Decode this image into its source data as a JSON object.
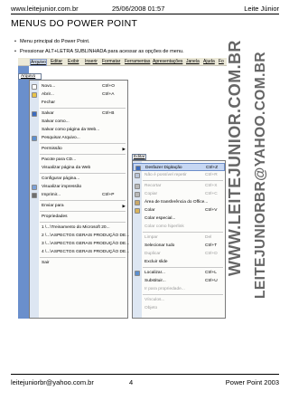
{
  "header": {
    "site": "www.leitejunior.com.br",
    "datetime": "25/06/2008 01:57",
    "author": "Leite Júnior"
  },
  "page_title": "MENUS DO POWER POINT",
  "bullets": [
    "Menu principal do Power Point.",
    "Pressionar ALT+LETRA SUBLINHADA para acessar as opções de menu."
  ],
  "menubar": [
    "Arquivo",
    "Editar",
    "Exibir",
    "Inserir",
    "Formatar",
    "Ferramentas",
    "Apresentações",
    "Janela",
    "Ajuda",
    "Fo"
  ],
  "arquivo_tab": "Arquivo",
  "arquivo_menu": [
    {
      "label": "Novo...",
      "shortcut": "Ctrl+O",
      "icon": "new-icon",
      "color": "#ffffff"
    },
    {
      "label": "Abrir...",
      "shortcut": "Ctrl+A",
      "icon": "open-folder-icon",
      "color": "#e8c34a"
    },
    {
      "label": "Fechar",
      "shortcut": "",
      "icon": "",
      "color": ""
    },
    {
      "sep": true
    },
    {
      "label": "Salvar",
      "shortcut": "Ctrl+B",
      "icon": "save-icon",
      "color": "#3c6cc0"
    },
    {
      "label": "Salvar como...",
      "shortcut": "",
      "icon": "",
      "color": ""
    },
    {
      "label": "Salvar como página da Web...",
      "shortcut": "",
      "icon": "",
      "color": ""
    },
    {
      "label": "Pesquisar Arquivo...",
      "shortcut": "",
      "icon": "search-file-icon",
      "color": "#5b8fd0"
    },
    {
      "sep": true
    },
    {
      "label": "Permissão",
      "shortcut": "",
      "icon": "",
      "color": "",
      "submenu": true
    },
    {
      "sep": true
    },
    {
      "label": "Pacote para CD...",
      "shortcut": "",
      "icon": "",
      "color": ""
    },
    {
      "label": "Visualizar página da Web",
      "shortcut": "",
      "icon": "",
      "color": ""
    },
    {
      "sep": true
    },
    {
      "label": "Configurar página...",
      "shortcut": "",
      "icon": "",
      "color": ""
    },
    {
      "label": "Visualizar impressão",
      "shortcut": "",
      "icon": "print-preview-icon",
      "color": "#7aa0d8"
    },
    {
      "label": "Imprimir...",
      "shortcut": "Ctrl+P",
      "icon": "print-icon",
      "color": "#6f6f6f"
    },
    {
      "sep": true
    },
    {
      "label": "Enviar para",
      "shortcut": "",
      "icon": "",
      "color": "",
      "submenu": true
    },
    {
      "sep": true
    },
    {
      "label": "Propriedades",
      "shortcut": "",
      "icon": "",
      "color": ""
    },
    {
      "sep": true
    },
    {
      "label": "1 \\...\\Treinamento do Microsoft 20...",
      "shortcut": "",
      "icon": "",
      "color": ""
    },
    {
      "label": "2 \\...\\ASPECTOS GERAIS PRODUÇÃO DE...",
      "shortcut": "",
      "icon": "",
      "color": ""
    },
    {
      "label": "3 \\...\\ASPECTOS GERAIS PRODUÇÃO DE...",
      "shortcut": "",
      "icon": "",
      "color": ""
    },
    {
      "label": "4 \\...\\ASPECTOS GERAIS PRODUÇÃO DE...",
      "shortcut": "",
      "icon": "",
      "color": ""
    },
    {
      "sep": true
    },
    {
      "label": "Sair",
      "shortcut": "",
      "icon": "",
      "color": ""
    }
  ],
  "editar_tab": "Editar",
  "editar_menu": [
    {
      "label": "Desfazer Digitação",
      "shortcut": "Ctrl+Z",
      "icon": "undo-icon",
      "color": "#3c6cc0",
      "disabled": false,
      "highlight": true
    },
    {
      "label": "Não é possível repetir",
      "shortcut": "Ctrl+R",
      "icon": "redo-icon",
      "color": "#b8c4d8",
      "disabled": true
    },
    {
      "sep": true
    },
    {
      "label": "Recortar",
      "shortcut": "Ctrl+X",
      "icon": "cut-icon",
      "color": "#b8b8b8",
      "disabled": true
    },
    {
      "label": "Copiar",
      "shortcut": "Ctrl+C",
      "icon": "copy-icon",
      "color": "#b8b8b8",
      "disabled": true
    },
    {
      "label": "Área de transferência do Office...",
      "shortcut": "",
      "icon": "clipboard-icon",
      "color": "#c9a86a"
    },
    {
      "label": "Colar",
      "shortcut": "Ctrl+V",
      "icon": "paste-icon",
      "color": "#d9b35a"
    },
    {
      "label": "Colar especial...",
      "shortcut": "",
      "icon": "",
      "color": ""
    },
    {
      "label": "Colar como hiperlink",
      "shortcut": "",
      "icon": "",
      "color": "",
      "disabled": true
    },
    {
      "sep": true
    },
    {
      "label": "Limpar",
      "shortcut": "Del",
      "icon": "",
      "color": "",
      "disabled": true
    },
    {
      "label": "Selecionar tudo",
      "shortcut": "Ctrl+T",
      "icon": "",
      "color": ""
    },
    {
      "label": "Duplicar",
      "shortcut": "Ctrl+D",
      "icon": "",
      "color": "",
      "disabled": true
    },
    {
      "label": "Excluir slide",
      "shortcut": "",
      "icon": "",
      "color": ""
    },
    {
      "sep": true
    },
    {
      "label": "Localizar...",
      "shortcut": "Ctrl+L",
      "icon": "find-icon",
      "color": "#5b8fd0"
    },
    {
      "label": "Substituir...",
      "shortcut": "Ctrl+U",
      "icon": "",
      "color": ""
    },
    {
      "label": "Ir para propriedade...",
      "shortcut": "",
      "icon": "",
      "color": "",
      "disabled": true
    },
    {
      "sep": true
    },
    {
      "label": "Vínculos...",
      "shortcut": "",
      "icon": "",
      "color": "",
      "disabled": true
    },
    {
      "label": "Objeto",
      "shortcut": "",
      "icon": "",
      "color": "",
      "disabled": true
    }
  ],
  "watermark": {
    "line1": "WWW.LEITEJUNIOR.COM.BR",
    "line2": "LEITEJUNIORBR@YAHOO.COM.BR"
  },
  "footer": {
    "email": "leitejuniorbr@yahoo.com.br",
    "page": "4",
    "product": "Power Point 2003"
  }
}
